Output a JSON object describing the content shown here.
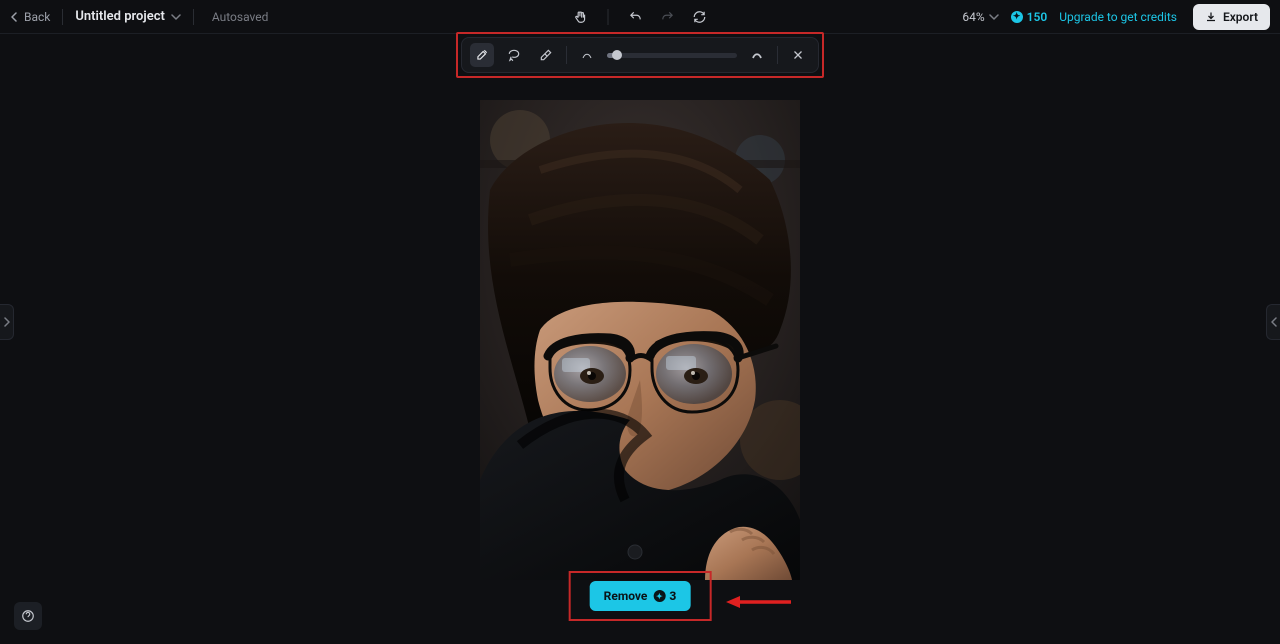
{
  "header": {
    "back_label": "Back",
    "project_name": "Untitled project",
    "autosaved_label": "Autosaved",
    "zoom": "64%",
    "credits": "150",
    "upgrade_label": "Upgrade to get credits",
    "export_label": "Export"
  },
  "toolbar": {
    "tools": [
      "brush",
      "lasso",
      "eraser"
    ],
    "active_tool": "brush",
    "brush_size_pct": 8
  },
  "action": {
    "remove_label": "Remove",
    "remove_cost": "3"
  },
  "accent_color": "#1cc6e6"
}
